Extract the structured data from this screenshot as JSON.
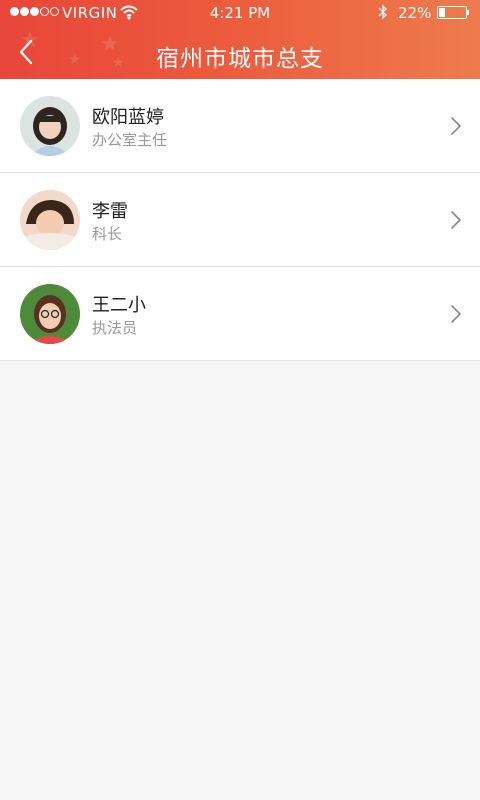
{
  "status_bar": {
    "carrier": "VIRGIN",
    "time": "4:21 PM",
    "battery_percent_text": "22%",
    "battery_level": 0.22,
    "signal_bars_filled": 3,
    "signal_bars_total": 5
  },
  "header": {
    "title": "宿州市城市总支",
    "accent_color": "#e8463a"
  },
  "contacts": [
    {
      "name": "欧阳蓝婷",
      "role": "办公室主任"
    },
    {
      "name": "李雷",
      "role": "科长"
    },
    {
      "name": "王二小",
      "role": "执法员"
    }
  ]
}
